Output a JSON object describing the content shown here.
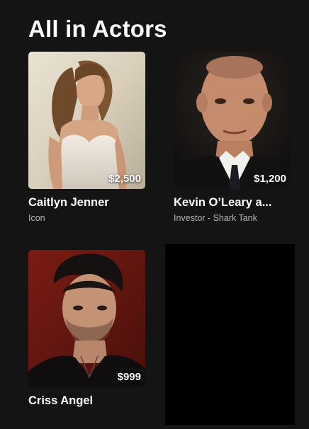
{
  "section": {
    "title": "All in Actors"
  },
  "cards": [
    {
      "name": "Caitlyn Jenner",
      "subtitle": "Icon",
      "price": "$2,500"
    },
    {
      "name": "Kevin O’Leary a...",
      "subtitle": "Investor - Shark Tank",
      "price": "$1,200"
    },
    {
      "name": "Criss Angel",
      "subtitle": "",
      "price": "$999"
    }
  ],
  "colors": {
    "background": "#141414",
    "text_primary": "#ffffff",
    "text_secondary": "#b5b5b5",
    "placeholder": "#000000"
  }
}
